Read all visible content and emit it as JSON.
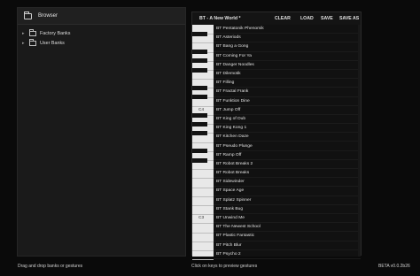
{
  "browser": {
    "title": "Browser",
    "items": [
      {
        "label": "Factory Banks",
        "expander": "▸"
      },
      {
        "label": "User Banks",
        "expander": "▸"
      }
    ]
  },
  "bank": {
    "name": "BT - A New World *",
    "toolbar": {
      "clear": "CLEAR",
      "load": "LOAD",
      "save": "SAVE",
      "save_as": "SAVE AS"
    },
    "key_labels": [
      {
        "label": "C4",
        "row": 9
      },
      {
        "label": "C3",
        "row": 21
      }
    ],
    "presets": [
      "BT Pentatonik Phenomik",
      "BT Asteriods",
      "BT Bang a Gong",
      "BT Coming For Ya",
      "BT Danger Noodles",
      "BT Dilemotik",
      "BT Filling",
      "BT Fractal Frank",
      "BT Funktion Dine",
      "BT Jump Off",
      "BT King of Dub",
      "BT King Kong 1",
      "BT Kitchen Daze",
      "BT Pseudo Plunge",
      "BT Ramp Off",
      "BT Robot Breaks 2",
      "BT Robot Breaks",
      "BT Sidewinder",
      "BT Space Age",
      "BT Splatz Spinner",
      "BT Stank Bug",
      "BT Unwind Me",
      "BT The Newest School",
      "BT Plastic Fantastic",
      "BT Pitch Blur",
      "BT Psycho 2"
    ]
  },
  "status": {
    "left": "Drag and drop banks or gestures",
    "mid": "Click on keys to preview gestures",
    "right": "BETA v0.0.2b26"
  }
}
